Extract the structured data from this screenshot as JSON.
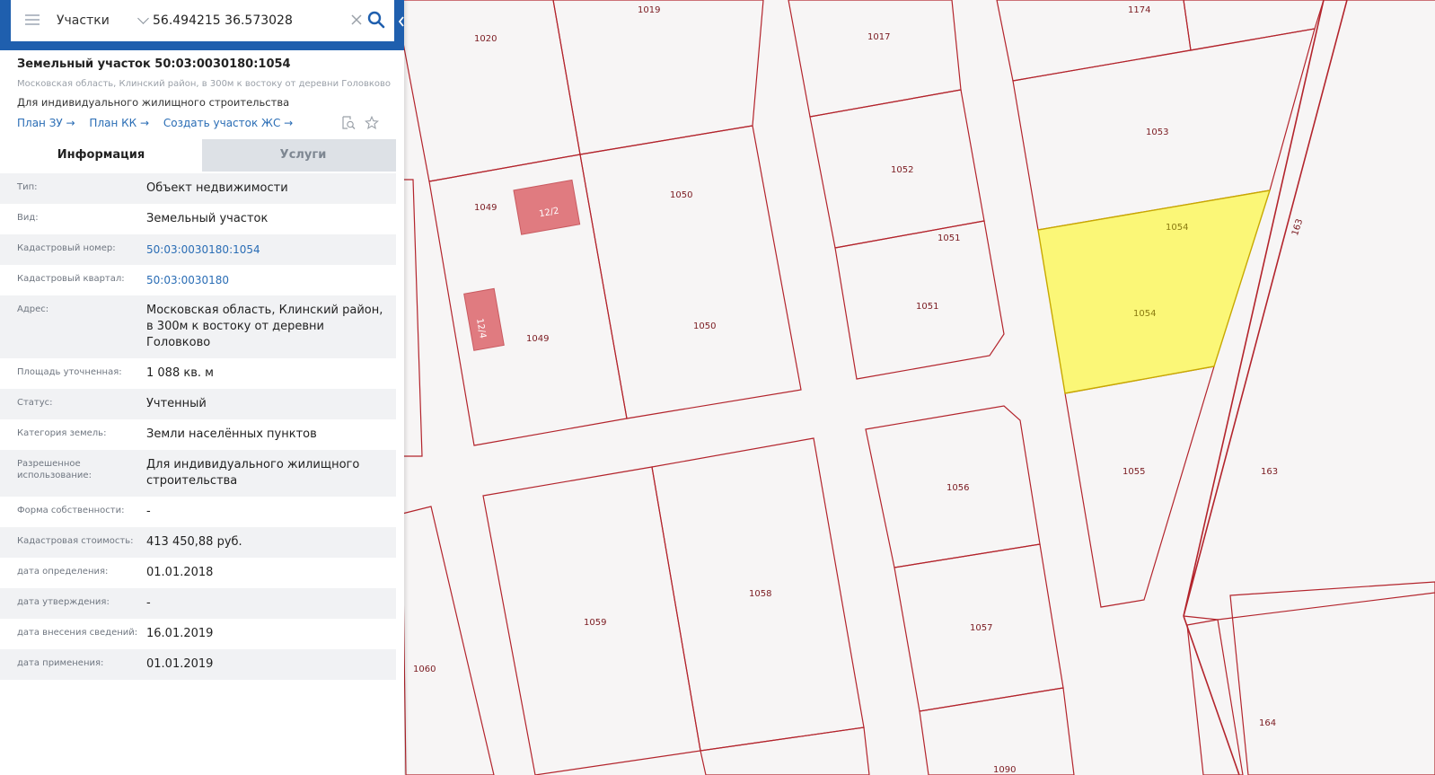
{
  "search": {
    "layer": "Участки",
    "query": "56.494215 36.573028"
  },
  "parcel": {
    "title": "Земельный участок 50:03:0030180:1054",
    "address_short": "Московская область, Клинский район, в 300м к востоку от деревни Головково",
    "usage": "Для индивидуального жилищного строительства",
    "links": [
      "План ЗУ →",
      "План КК →",
      "Создать участок ЖС →"
    ]
  },
  "tabs": [
    "Информация",
    "Услуги"
  ],
  "info_rows": [
    {
      "key": "Тип:",
      "value": "Объект недвижимости"
    },
    {
      "key": "Вид:",
      "value": "Земельный участок"
    },
    {
      "key": "Кадастровый номер:",
      "value": "50:03:0030180:1054",
      "link": true
    },
    {
      "key": "Кадастровый квартал:",
      "value": "50:03:0030180",
      "link": true
    },
    {
      "key": "Адрес:",
      "value": "Московская область, Клинский район, в 300м к востоку от деревни Головково"
    },
    {
      "key": "Площадь уточненная:",
      "value": "1 088 кв. м"
    },
    {
      "key": "Статус:",
      "value": "Учтенный"
    },
    {
      "key": "Категория земель:",
      "value": "Земли населённых пунктов"
    },
    {
      "key": "Разрешенное использование:",
      "value": "Для индивидуального жилищного строительства"
    },
    {
      "key": "Форма собственности:",
      "value": "-"
    },
    {
      "key": "Кадастровая стоимость:",
      "value": "413 450,88 руб."
    },
    {
      "key": "дата определения:",
      "value": "01.01.2018"
    },
    {
      "key": "дата утверждения:",
      "value": "-"
    },
    {
      "key": "дата внесения сведений:",
      "value": "16.01.2019"
    },
    {
      "key": "дата применения:",
      "value": "01.01.2019"
    }
  ],
  "map_labels": {
    "p1019": "1019",
    "p1020": "1020",
    "p1017": "1017",
    "p1174": "1174",
    "p1053": "1053",
    "p1052": "1052",
    "p1049a": "1049",
    "p1049b": "1049",
    "p1050a": "1050",
    "p1050b": "1050",
    "p1051a": "1051",
    "p1051b": "1051",
    "p1054a": "1054",
    "p1054b": "1054",
    "p163a": "163",
    "p163b": "163",
    "b12_2": "12/2",
    "b12_4": "12/4",
    "p1055": "1055",
    "p1056": "1056",
    "p1057": "1057",
    "p1058": "1058",
    "p1059": "1059",
    "p1060": "1060",
    "p1090": "1090",
    "p164": "164"
  },
  "colors": {
    "parcel_border": "#b3242c",
    "selected_fill": "#fbf777",
    "building_fill": "#e07b80",
    "accent": "#1f5fae",
    "map_bg": "#f7f5f5"
  }
}
